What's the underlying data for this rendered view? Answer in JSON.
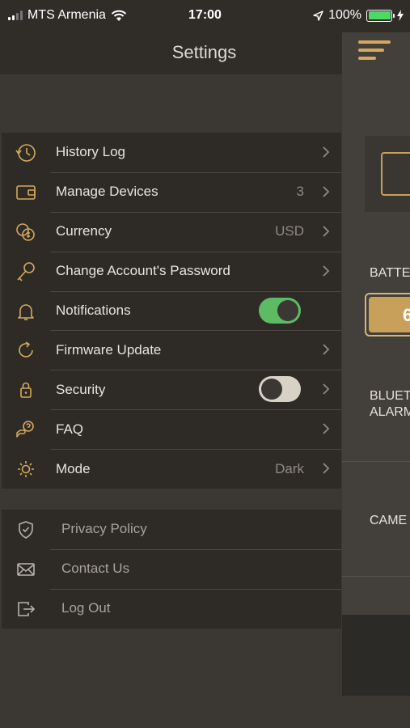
{
  "status_bar": {
    "carrier": "MTS Armenia",
    "time": "17:00",
    "battery": "100%"
  },
  "header": {
    "title": "Settings"
  },
  "main_panel": {
    "battery_label": "BATTE",
    "battery_value": "6",
    "bluetooth_label": "BLUET",
    "alarm_label": "ALARM",
    "camera_label": "CAME"
  },
  "settings": {
    "items": [
      {
        "label": "History Log",
        "value": "",
        "icon": "history-clock-icon"
      },
      {
        "label": "Manage Devices",
        "value": "3",
        "icon": "wallet-icon"
      },
      {
        "label": "Currency",
        "value": "USD",
        "icon": "coins-icon"
      },
      {
        "label": "Change Account's Password",
        "value": "",
        "icon": "key-icon"
      },
      {
        "label": "Notifications",
        "value": "",
        "icon": "bell-icon",
        "toggle": true
      },
      {
        "label": "Firmware Update",
        "value": "",
        "icon": "refresh-icon"
      },
      {
        "label": "Security",
        "value": "",
        "icon": "lock-icon",
        "toggle": false
      },
      {
        "label": "FAQ",
        "value": "",
        "icon": "faq-icon"
      },
      {
        "label": "Mode",
        "value": "Dark",
        "icon": "sun-icon"
      }
    ]
  },
  "footer": {
    "items": [
      {
        "label": "Privacy Policy",
        "icon": "shield-icon"
      },
      {
        "label": "Contact Us",
        "icon": "envelope-icon"
      },
      {
        "label": "Log Out",
        "icon": "logout-icon"
      }
    ]
  },
  "colors": {
    "accent": "#d4a95c",
    "toggle_on": "#5dbb63",
    "background": "#3b3833",
    "list_background": "#2e2b27"
  }
}
